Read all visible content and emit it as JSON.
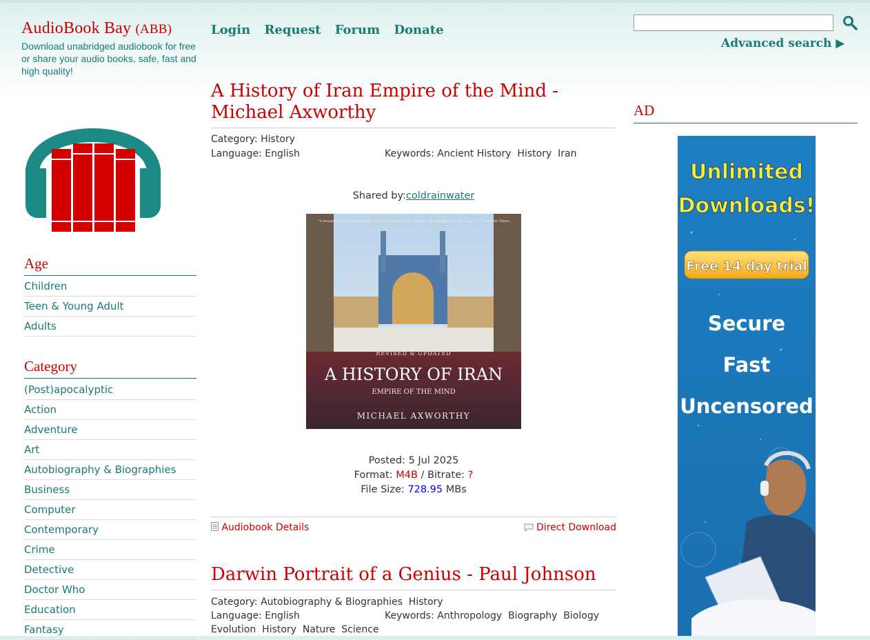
{
  "header": {
    "site_name_main": "AudioBook Bay",
    "site_name_abbr": "(ABB)",
    "tagline": "Download unabridged audiobook for free or share your audio books, safe, fast and high quality!",
    "nav": [
      "Login",
      "Request",
      "Forum",
      "Donate"
    ],
    "search_placeholder": "",
    "advanced_search": "Advanced search ▶"
  },
  "sidebar": {
    "age_heading": "Age",
    "age_items": [
      "Children",
      "Teen & Young Adult",
      "Adults"
    ],
    "category_heading": "Category",
    "category_items": [
      "(Post)apocalyptic",
      "Action",
      "Adventure",
      "Art",
      "Autobiography & Biographies",
      "Business",
      "Computer",
      "Contemporary",
      "Crime",
      "Detective",
      "Doctor Who",
      "Education",
      "Fantasy"
    ]
  },
  "posts": [
    {
      "title": "A History of Iran Empire of the Mind - Michael Axworthy",
      "category_label": "Category:",
      "category": "History",
      "language_label": "Language:",
      "language": "English",
      "keywords_label": "Keywords:",
      "keywords": "Ancient History  History  Iran",
      "shared_label": "Shared by:",
      "shared_by": "coldrainwater",
      "cover": {
        "quote": "\"A beautifully distilled retelling of Iranian history that flashes with insight on every page.\" — Financial Times",
        "edition": "REVISED & UPDATED",
        "book_title": "A HISTORY OF IRAN",
        "subtitle": "EMPIRE OF THE MIND",
        "author": "MICHAEL AXWORTHY"
      },
      "posted_label": "Posted:",
      "posted": "5 Jul 2025",
      "format_label": "Format:",
      "format": "M4B",
      "bitrate_label": "/ Bitrate:",
      "bitrate": "?",
      "filesize_label": "File Size:",
      "filesize": "728.95",
      "filesize_unit": "MBs",
      "details_link": "Audiobook Details",
      "download_link": "Direct Download"
    },
    {
      "title": "Darwin Portrait of a Genius - Paul Johnson",
      "category_label": "Category:",
      "category": "Autobiography & Biographies  History",
      "language_label": "Language:",
      "language": "English",
      "keywords_label": "Keywords:",
      "keywords": "Anthropology  Biography  Biology",
      "keywords_cont": "Evolution  History  Nature  Science"
    }
  ],
  "ad": {
    "heading": "AD",
    "line1": "Unlimited",
    "line2": "Downloads!",
    "trial": "Free 14 day trial",
    "secure": "Secure",
    "fast": "Fast",
    "uncensored": "Uncensored"
  },
  "colors": {
    "accent_red": "#cc0000",
    "accent_teal": "#1a7a74",
    "ad_blue": "#1b7cc0"
  }
}
